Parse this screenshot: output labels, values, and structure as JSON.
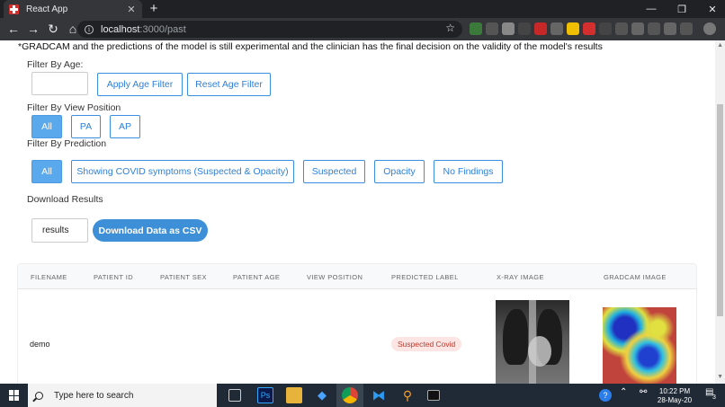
{
  "browser": {
    "tab_title": "React App",
    "tab_close": "✕",
    "new_tab": "+",
    "url_host": "localhost",
    "url_path": ":3000/past",
    "back": "←",
    "forward": "→",
    "reload": "↻",
    "home": "⌂",
    "minimize": "—",
    "restore": "❐",
    "close": "✕"
  },
  "page": {
    "disclaimer": "*GRADCAM and the predictions of the model is still experimental and the clinician has the final decision on the validity of the model's results",
    "age_filter": {
      "label": "Filter By Age:",
      "input_value": "",
      "apply_label": "Apply Age Filter",
      "reset_label": "Reset Age Filter"
    },
    "view_filter": {
      "label": "Filter By View Position",
      "options": [
        "All",
        "PA",
        "AP"
      ],
      "selected": "All"
    },
    "prediction_filter": {
      "label": "Filter By Prediction",
      "options": [
        "All",
        "Showing COVID symptoms (Suspected & Opacity)",
        "Suspected",
        "Opacity",
        "No Findings"
      ],
      "selected": "All"
    },
    "download": {
      "label": "Download Results",
      "filename_value": "results",
      "button_label": "Download Data as CSV"
    },
    "table": {
      "headers": [
        "FILENAME",
        "PATIENT ID",
        "PATIENT SEX",
        "PATIENT AGE",
        "VIEW POSITION",
        "PREDICTED LABEL",
        "X-RAY IMAGE",
        "GRADCAM IMAGE"
      ],
      "rows": [
        {
          "filename": "demo",
          "patient_id": "",
          "patient_sex": "",
          "patient_age": "",
          "view_position": "",
          "predicted_label": "Suspected Covid"
        }
      ]
    }
  },
  "taskbar": {
    "search_placeholder": "Type here to search",
    "time": "10:22 PM",
    "date": "28-May-20",
    "notification_count": "3"
  },
  "colors": {
    "primary": "#3b8fe0",
    "active_button": "#5aa9ec",
    "badge_bg": "#fde5e3",
    "badge_text": "#c0392b"
  }
}
